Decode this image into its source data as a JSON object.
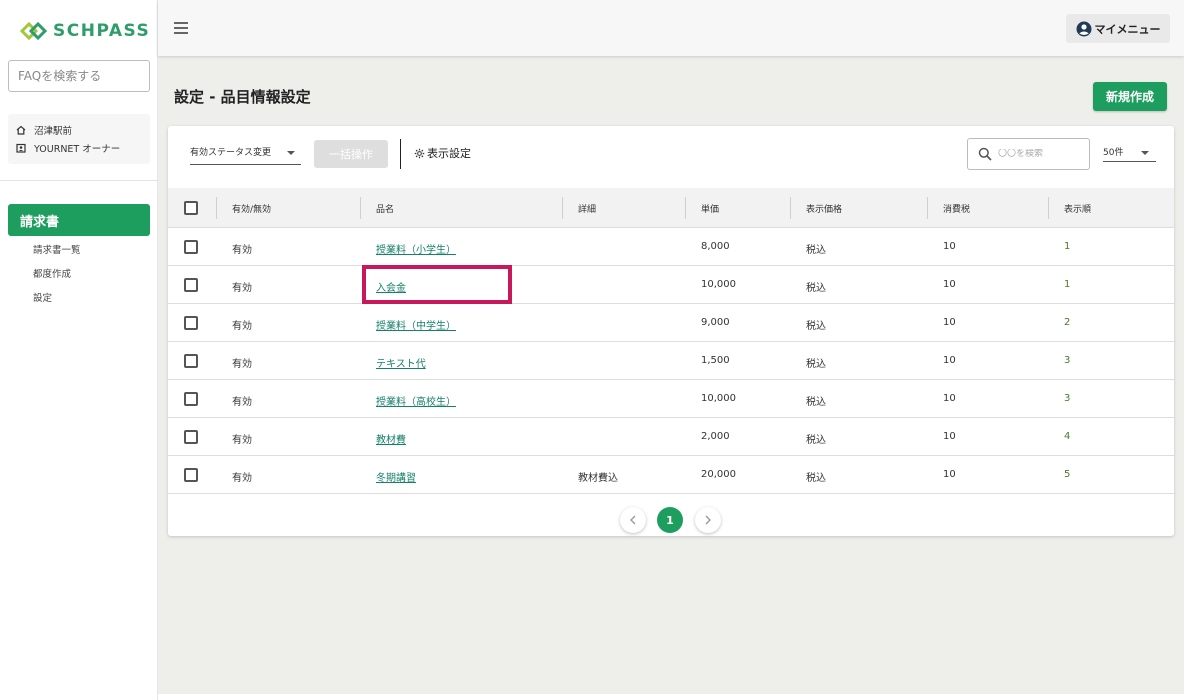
{
  "brand": {
    "name": "SCHPASS",
    "accent": "#1e9e5e"
  },
  "sidebar": {
    "faq_placeholder": "FAQを検索する",
    "org": [
      {
        "icon": "home-icon",
        "label": "沼津駅前"
      },
      {
        "icon": "badge-icon",
        "label": "YOURNET オーナー"
      }
    ],
    "active_section": "請求書",
    "sub_items": [
      "請求書一覧",
      "都度作成",
      "設定"
    ]
  },
  "topbar": {
    "my_menu": "マイメニュー"
  },
  "page": {
    "title": "設定 - 品目情報設定",
    "new_button": "新規作成"
  },
  "toolbar": {
    "status_select": "有効ステータス変更",
    "bulk_button": "一括操作",
    "display_setting": "表示設定",
    "search_placeholder": "〇〇を検索",
    "count_select": "50件"
  },
  "table": {
    "headers": [
      "有効/無効",
      "品名",
      "詳細",
      "単価",
      "表示価格",
      "消費税",
      "表示順"
    ],
    "rows": [
      {
        "status": "有効",
        "name": "授業料（小学生）",
        "detail": "",
        "price": "8,000",
        "display_price": "税込",
        "tax": "10",
        "order": "1"
      },
      {
        "status": "有効",
        "name": "入会金",
        "detail": "",
        "price": "10,000",
        "display_price": "税込",
        "tax": "10",
        "order": "1"
      },
      {
        "status": "有効",
        "name": "授業料（中学生）",
        "detail": "",
        "price": "9,000",
        "display_price": "税込",
        "tax": "10",
        "order": "2"
      },
      {
        "status": "有効",
        "name": "テキスト代",
        "detail": "",
        "price": "1,500",
        "display_price": "税込",
        "tax": "10",
        "order": "3"
      },
      {
        "status": "有効",
        "name": "授業料（高校生）",
        "detail": "",
        "price": "10,000",
        "display_price": "税込",
        "tax": "10",
        "order": "3"
      },
      {
        "status": "有効",
        "name": "教材費",
        "detail": "",
        "price": "2,000",
        "display_price": "税込",
        "tax": "10",
        "order": "4"
      },
      {
        "status": "有効",
        "name": "冬期講習",
        "detail": "教材費込",
        "price": "20,000",
        "display_price": "税込",
        "tax": "10",
        "order": "5"
      }
    ]
  },
  "pagination": {
    "current": "1"
  }
}
